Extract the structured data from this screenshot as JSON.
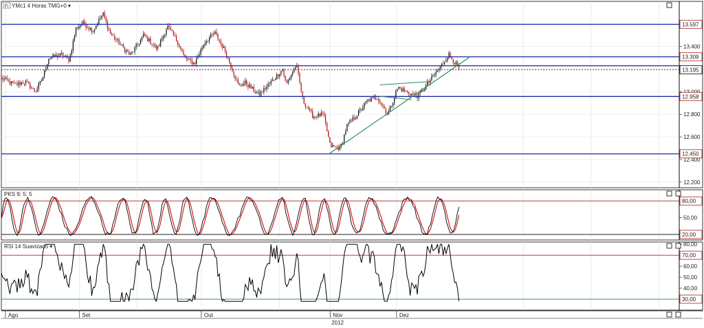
{
  "instrument": "YMc1",
  "interval": "4 Horas",
  "timezone": "TMG+0",
  "colors": {
    "level_line": "#1a2aa8",
    "reference_line": "#b02020",
    "trendline": "#2e8b57",
    "candle_up": "#111111",
    "candle_down": "#b01010",
    "indicator_line": "#000000",
    "signal_line": "#d02020",
    "rsi_low_line": "#2a8a2a",
    "grid": "#e6e6e6",
    "label_fill": "#ffffff"
  },
  "panels": [
    {
      "id": "price",
      "title": "YMc1 4 Horas TMG+0",
      "ylim": [
        12150,
        13800
      ],
      "y_ticks": [
        12200,
        12400,
        12600,
        12800,
        13000,
        13200,
        13400,
        13600
      ],
      "y_tick_labels": [
        "12.200",
        "12.400",
        "12.600",
        "12.800",
        "13.000",
        "13.200",
        "13.400",
        "13.600"
      ],
      "levels": [
        {
          "value": 13597,
          "label": "13.597",
          "kind": "horizontal"
        },
        {
          "value": 13309,
          "label": "13.309",
          "kind": "horizontal"
        },
        {
          "value": 13230,
          "label": "",
          "kind": "horizontal"
        },
        {
          "value": 13195,
          "label": "13.195",
          "kind": "current"
        },
        {
          "value": 12958,
          "label": "12.958",
          "kind": "horizontal"
        },
        {
          "value": 12450,
          "label": "12.450",
          "kind": "horizontal"
        }
      ],
      "trendlines": [
        {
          "x0": 0.4835,
          "y0": 12450,
          "x1": 0.6714,
          "y1": 13250
        }
      ],
      "channel_lines": [
        {
          "x0": 0.558,
          "y0": 13060,
          "x1": 0.632,
          "y1": 13090
        },
        {
          "x0": 0.558,
          "y0": 12960,
          "x1": 0.605,
          "y1": 12930
        }
      ],
      "path_anchors": [
        [
          0.0,
          13120
        ],
        [
          0.02,
          13060
        ],
        [
          0.035,
          13090
        ],
        [
          0.05,
          13000
        ],
        [
          0.06,
          13110
        ],
        [
          0.07,
          13300
        ],
        [
          0.09,
          13330
        ],
        [
          0.1,
          13280
        ],
        [
          0.11,
          13560
        ],
        [
          0.12,
          13610
        ],
        [
          0.135,
          13540
        ],
        [
          0.15,
          13690
        ],
        [
          0.16,
          13520
        ],
        [
          0.175,
          13420
        ],
        [
          0.19,
          13320
        ],
        [
          0.21,
          13500
        ],
        [
          0.23,
          13380
        ],
        [
          0.245,
          13580
        ],
        [
          0.26,
          13440
        ],
        [
          0.27,
          13300
        ],
        [
          0.285,
          13250
        ],
        [
          0.3,
          13440
        ],
        [
          0.315,
          13520
        ],
        [
          0.33,
          13360
        ],
        [
          0.35,
          13050
        ],
        [
          0.36,
          13080
        ],
        [
          0.38,
          12970
        ],
        [
          0.4,
          13100
        ],
        [
          0.415,
          13200
        ],
        [
          0.42,
          13060
        ],
        [
          0.435,
          13240
        ],
        [
          0.445,
          12920
        ],
        [
          0.46,
          12780
        ],
        [
          0.475,
          12800
        ],
        [
          0.485,
          12520
        ],
        [
          0.5,
          12500
        ],
        [
          0.51,
          12700
        ],
        [
          0.525,
          12800
        ],
        [
          0.54,
          12920
        ],
        [
          0.555,
          12950
        ],
        [
          0.57,
          12800
        ],
        [
          0.585,
          13040
        ],
        [
          0.6,
          12990
        ],
        [
          0.615,
          12960
        ],
        [
          0.63,
          13080
        ],
        [
          0.645,
          13200
        ],
        [
          0.66,
          13330
        ],
        [
          0.67,
          13250
        ],
        [
          0.675,
          13200
        ]
      ]
    },
    {
      "id": "pks",
      "title": "PKS 9; 5; 5",
      "ylim": [
        10,
        100
      ],
      "y_ticks": [
        50
      ],
      "y_tick_labels": [
        "50,00"
      ],
      "levels": [
        {
          "value": 80,
          "label": "80,00",
          "color_key": "reference_line"
        },
        {
          "value": 20,
          "label": "20,00",
          "color_key": "indicator_line"
        }
      ],
      "value_range": [
        18,
        88
      ]
    },
    {
      "id": "rsi",
      "title": "RSI 14 Suavizado",
      "ylim": [
        20,
        82
      ],
      "y_ticks": [
        40,
        50,
        60,
        80
      ],
      "y_tick_labels": [
        "40,00",
        "50,00",
        "60,00",
        "80,00"
      ],
      "levels": [
        {
          "value": 70,
          "label": "70,00",
          "color_key": "reference_line"
        },
        {
          "value": 30,
          "label": "30,00",
          "color_key": "rsi_low_line"
        }
      ],
      "value_range": [
        28,
        80
      ]
    }
  ],
  "x_axis": {
    "months": [
      {
        "label": "Ago",
        "pos": 0.006
      },
      {
        "label": "Set",
        "pos": 0.115
      },
      {
        "label": "Out",
        "pos": 0.295
      },
      {
        "label": "Nov",
        "pos": 0.485
      },
      {
        "label": "Dez",
        "pos": 0.583
      }
    ],
    "year_label": "2012",
    "year_pos": 0.485
  }
}
